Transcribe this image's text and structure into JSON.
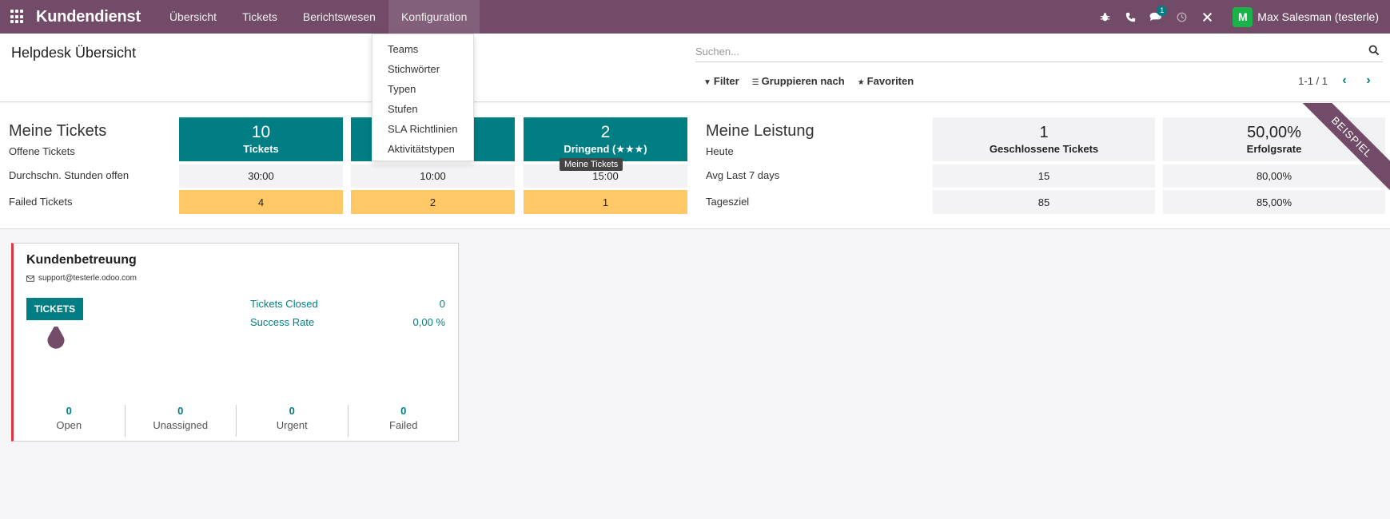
{
  "navbar": {
    "brand": "Kundendienst",
    "menu": [
      "Übersicht",
      "Tickets",
      "Berichtswesen",
      "Konfiguration"
    ],
    "chat_badge": "1",
    "user_initial": "M",
    "user_name": "Max Salesman (testerle)"
  },
  "dropdown": {
    "items": [
      "Teams",
      "Stichwörter",
      "Typen",
      "Stufen",
      "SLA Richtlinien",
      "Aktivitätstypen"
    ]
  },
  "control": {
    "title": "Helpdesk Übersicht",
    "search_placeholder": "Suchen...",
    "filter": "Filter",
    "group_by": "Gruppieren nach",
    "favorites": "Favoriten",
    "pager": "1-1 / 1"
  },
  "dashboard": {
    "my_tickets_title": "Meine Tickets",
    "row_labels": [
      "Offene Tickets",
      "Durchschn. Stunden offen",
      "Failed Tickets"
    ],
    "columns": [
      {
        "count": "10",
        "label": "Tickets",
        "hours": "30:00",
        "failed": "4"
      },
      {
        "count": "",
        "label": "",
        "hours": "10:00",
        "failed": "2"
      },
      {
        "count": "2",
        "label": "Dringend (★★★)",
        "hours": "15:00",
        "failed": "1"
      }
    ],
    "tooltip": "Meine Tickets",
    "performance_title": "Meine Leistung",
    "perf_labels": [
      "Heute",
      "Avg Last 7 days",
      "Tagesziel"
    ],
    "perf_columns": [
      {
        "value": "1",
        "label": "Geschlossene Tickets",
        "avg": "15",
        "goal": "85"
      },
      {
        "value": "50,00%",
        "label": "Erfolgsrate",
        "avg": "80,00%",
        "goal": "85,00%"
      }
    ],
    "ribbon": "BEISPIEL"
  },
  "card": {
    "title": "Kundenbetreuung",
    "email": "support@testerle.odoo.com",
    "tickets_button": "TICKETS",
    "stats": [
      {
        "label": "Tickets Closed",
        "value": "0"
      },
      {
        "label": "Success Rate",
        "value": "0,00 %"
      }
    ],
    "bottom": [
      {
        "value": "0",
        "label": "Open"
      },
      {
        "value": "0",
        "label": "Unassigned"
      },
      {
        "value": "0",
        "label": "Urgent"
      },
      {
        "value": "0",
        "label": "Failed"
      }
    ]
  },
  "colors": {
    "brand": "#714b67",
    "teal": "#017e84",
    "warning": "#fec867",
    "danger": "#e0363f"
  }
}
